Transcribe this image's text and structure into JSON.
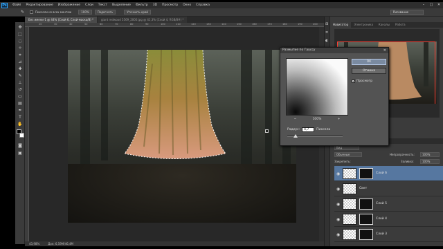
{
  "menu": {
    "logo": "Ps",
    "items": [
      "Файл",
      "Редактирование",
      "Изображение",
      "Слои",
      "Текст",
      "Выделение",
      "Фильтр",
      "3D",
      "Просмотр",
      "Окно",
      "Справка"
    ],
    "minimize": "–",
    "maximize": "□",
    "close": "✕"
  },
  "options": {
    "sample_all_label": "Пиксели из всех монтаж",
    "size_value": "100%",
    "refine_button": "Подогнать",
    "fill_button": "Уточнить край",
    "workspace": "Рисование"
  },
  "documents": {
    "tabs": [
      "Без имени-1 @ 44% (Слой 6, Слой-маска/8) *",
      "giant redwood 5569_2000.jpg @ 41,3% (Слой 4, RGB/8#) *"
    ]
  },
  "ruler": {
    "top_numbers": [
      "20",
      "30",
      "40",
      "50",
      "60",
      "70",
      "80",
      "90",
      "100",
      "110",
      "120",
      "130",
      "140",
      "150",
      "160",
      "170",
      "180",
      "190",
      "200"
    ]
  },
  "status": {
    "zoom": "43,98%",
    "doc_info": "Док: 6,59M/46,4M"
  },
  "navigator": {
    "tabs": [
      "Навигатор",
      "Электроника",
      "Каналы",
      "Работа"
    ]
  },
  "layers_panel": {
    "kind_filter": "Вид",
    "blend_mode": "Обычные",
    "opacity_label": "Непрозрачность:",
    "opacity_value": "100%",
    "lock_label": "Закрепить:",
    "fill_label": "Заливка:",
    "fill_value": "100%",
    "layers": [
      {
        "name": "Слой 6",
        "active": true,
        "has_mask": true
      },
      {
        "name": "Свет",
        "active": false,
        "has_mask": false
      },
      {
        "name": "Слой 5",
        "active": false,
        "has_mask": true
      },
      {
        "name": "Слой 4",
        "active": false,
        "has_mask": true
      },
      {
        "name": "Слой 3",
        "active": false,
        "has_mask": true
      }
    ]
  },
  "dialog": {
    "title": "Размытие по Гауссу",
    "close": "✕",
    "ok": "OK",
    "cancel": "Отмена",
    "preview_label": "Просмотр",
    "preview_checked": "✓",
    "zoom_out": "−",
    "zoom_value": "100%",
    "zoom_in": "+",
    "radius_label": "Радиус:",
    "radius_value": "4,7",
    "radius_unit": "Пиксели"
  },
  "colors": {
    "ps_blue": "#31a8ff",
    "selection_highlight": "#5677a0",
    "nav_frame": "#ff3b30"
  }
}
